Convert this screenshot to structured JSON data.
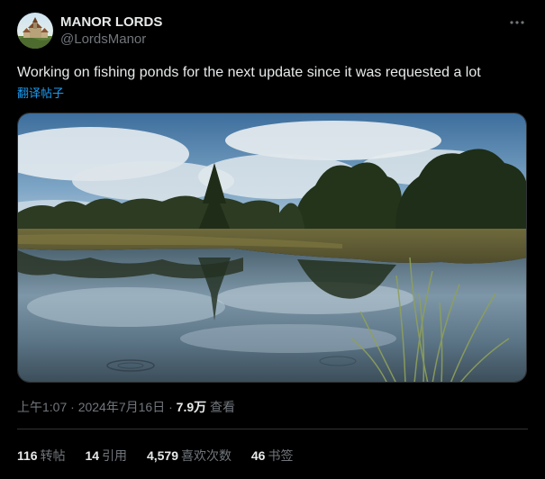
{
  "author": {
    "display_name": "MANOR LORDS",
    "handle": "@LordsManor"
  },
  "tweet": {
    "text": "Working on fishing ponds for the next update since it was requested a lot",
    "translate_label": "翻译帖子"
  },
  "meta": {
    "time": "上午1:07",
    "separator1": "·",
    "date": "2024年7月16日",
    "separator2": "·",
    "views_count": "7.9万",
    "views_label": "查看"
  },
  "stats": {
    "reposts": {
      "count": "116",
      "label": "转帖"
    },
    "quotes": {
      "count": "14",
      "label": "引用"
    },
    "likes": {
      "count": "4,579",
      "label": "喜欢次数"
    },
    "bookmarks": {
      "count": "46",
      "label": "书签"
    }
  },
  "icons": {
    "more": "more-horizontal-icon"
  }
}
